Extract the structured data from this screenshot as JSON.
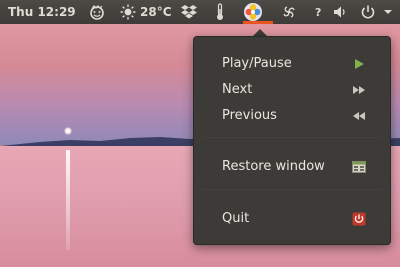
{
  "panel": {
    "clock": "Thu 12:29",
    "temperature": "28°C",
    "help_glyph": "?",
    "icons": [
      "emoticon-icon",
      "sun-icon",
      "dropbox-icon",
      "thermometer-icon",
      "music-player-icon",
      "spiral-icon",
      "help-icon",
      "volume-icon",
      "power-icon",
      "chevron-down-icon"
    ]
  },
  "menu": {
    "items": [
      {
        "label": "Play/Pause",
        "icon": "play-icon"
      },
      {
        "label": "Next",
        "icon": "next-icon"
      },
      {
        "label": "Previous",
        "icon": "previous-icon"
      },
      {
        "label": "Restore window",
        "icon": "window-icon"
      },
      {
        "label": "Quit",
        "icon": "quit-icon"
      }
    ]
  },
  "colors": {
    "panel_bg": "#3c3b37",
    "accent": "#e95420",
    "play_green": "#7fb24a",
    "quit_red": "#c0392b"
  }
}
